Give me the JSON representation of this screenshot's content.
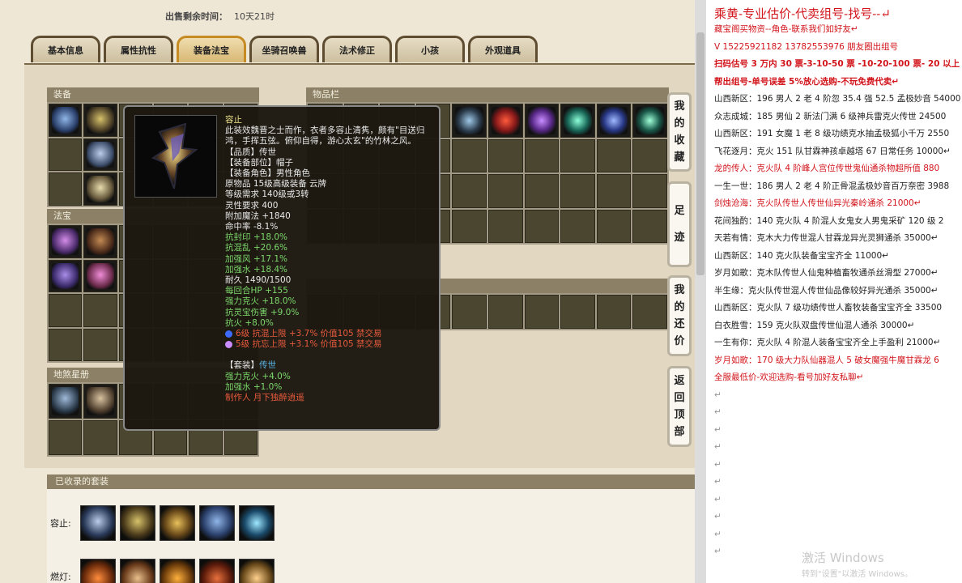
{
  "sell": {
    "label": "出售剩余时间：",
    "value": "10天21时"
  },
  "tabs": [
    "基本信息",
    "属性抗性",
    "装备法宝",
    "坐骑召唤兽",
    "法术修正",
    "小孩",
    "外观道具"
  ],
  "sections": {
    "equip": "装备",
    "treasure": "法宝",
    "formation": "地煞星册",
    "items": "物品栏",
    "collected": "已收录的套装"
  },
  "tooltip": {
    "name": "容止",
    "desc": "此装效魏晋之士而作，衣者多容止清隽，颇有\"目送归鸿，手挥五弦。俯仰自得，游心太玄\"的竹林之风。",
    "quality": "【品质】传世",
    "slot": "【装备部位】帽子",
    "role": "【装备角色】男性角色",
    "origin": "原物品 15级高级装备 云牌",
    "req_level": "等级需求 140级或3转",
    "spirit": "灵性要求 400",
    "magic": "附加魔法 +1840",
    "hit": "命中率 -8.1%",
    "stats_green": [
      "抗封印 +18.0%",
      "抗混乱 +20.6%",
      "加强风 +17.1%",
      "加强水 +18.4%"
    ],
    "durability": "耐久 1490/1500",
    "stats_green2": [
      "每回合HP +155",
      "强力克火 +18.0%",
      "抗灵宝伤害 +9.0%",
      "抗火 +8.0%"
    ],
    "gems": [
      "6级 抗混上限 +3.7% 价值105 禁交易",
      "5级 抗忘上限 +3.1% 价值105 禁交易"
    ],
    "set_label": "【套装】",
    "set_name": "传世",
    "set_stats": [
      "强力克火 +4.0%",
      "加强水 +1.0%"
    ],
    "maker": "制作人 月下独醉逍遥"
  },
  "side_buttons": [
    [
      "我",
      "的",
      "收",
      "藏"
    ],
    [
      "足",
      "迹"
    ],
    [
      "我",
      "的",
      "还",
      "价"
    ],
    [
      "返",
      "回",
      "顶",
      "部"
    ]
  ],
  "sets": [
    {
      "name": "容止:"
    },
    {
      "name": "燃灯:"
    }
  ],
  "doc": {
    "title": "乘黄-专业估价-代卖组号-找号--↵",
    "lines": [
      {
        "t": "藏宝阁买物资--角色-联系我们如好友↵",
        "c": "red"
      },
      {
        "t": "V 15225921182   13782553976 朋友圈出组号",
        "c": "red"
      },
      {
        "t": "扫码估号 3 万内 30 票-3-10-50 票 -10-20-100 票- 20 以上",
        "c": "redb"
      },
      {
        "t": "帮出组号-单号误差 5%放心选购-不玩免费代卖↵",
        "c": "redb"
      },
      {
        "t": "山西新区：196 男人 2 老 4 阶忽 35.4 强 52.5 孟极妙音 54000",
        "c": ""
      },
      {
        "t": "众志成城：185 男仙 2 新法门满 6 级神兵雷克火传世 24500",
        "c": ""
      },
      {
        "t": "山西新区：191 女魔 1 老 8 级功绩克水抽孟极狐小千万 2550",
        "c": ""
      },
      {
        "t": "飞花逐月：克火 151 队甘霖神孩卓越塔 67 日常任务 10000↵",
        "c": ""
      },
      {
        "t": "龙的传人：克火队 4 阶峰人宫位传世鬼仙通杀物超所值 880",
        "c": "red"
      },
      {
        "t": "一生一世：186 男人 2 老 4 阶正骨混孟极妙音百万奈密 3988",
        "c": ""
      },
      {
        "t": "剑烛沧海：克火队传世人传世仙异光秦岭通杀 21000↵",
        "c": "red"
      },
      {
        "t": "花间独酌：140 克火队 4 阶混人女鬼女人男鬼采矿 120 级 2",
        "c": ""
      },
      {
        "t": "天若有情：克木大力传世混人甘霖龙异光灵狮通杀 35000↵",
        "c": ""
      },
      {
        "t": "山西新区：140 克火队装备宝宝齐全 11000↵",
        "c": ""
      },
      {
        "t": "岁月如歌：克木队传世人仙鬼种植畜牧通杀丝滑型 27000↵",
        "c": ""
      },
      {
        "t": "半生缘：克火队传世混人传世仙品像较好异光通杀 35000↵",
        "c": ""
      },
      {
        "t": "山西新区：克火队 7 级功绩传世人畜牧装备宝宝齐全 33500",
        "c": ""
      },
      {
        "t": "白衣胜雪：159 克火队双盘传世仙混人通杀 30000↵",
        "c": ""
      },
      {
        "t": "一生有你：克火队 4 阶混人装备宝宝齐全上手盈利 21000↵",
        "c": ""
      },
      {
        "t": "岁月如歌：170 级大力队仙器混人 5 破女魔强牛魔甘霖龙 6",
        "c": "red"
      },
      {
        "t": "全服最低价-欢迎选购-看号加好友私聊↵",
        "c": "red"
      },
      {
        "t": "↵",
        "c": "empty"
      },
      {
        "t": "↵",
        "c": "empty"
      },
      {
        "t": "↵",
        "c": "empty"
      },
      {
        "t": "↵",
        "c": "empty"
      },
      {
        "t": "↵",
        "c": "empty"
      },
      {
        "t": "↵",
        "c": "empty"
      },
      {
        "t": "↵",
        "c": "empty"
      },
      {
        "t": "↵",
        "c": "empty"
      },
      {
        "t": "↵",
        "c": "empty"
      },
      {
        "t": "↵",
        "c": "empty"
      }
    ]
  },
  "watermark": {
    "main": "激活 Windows",
    "sub": "转到\"设置\"以激活 Windows。"
  }
}
